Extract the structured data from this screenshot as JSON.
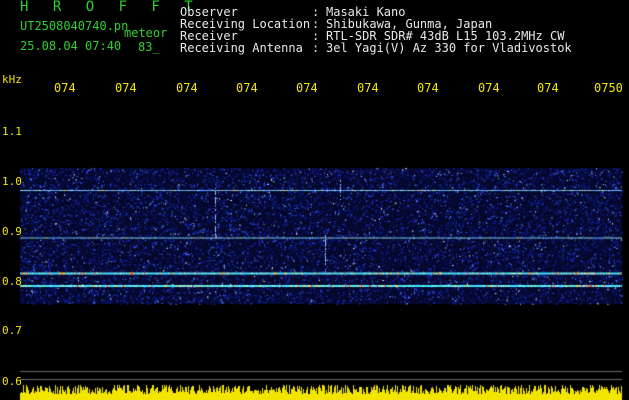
{
  "header": {
    "brand": "H R O F F T",
    "filename": "UT2508040740.pn",
    "datetime": "25.08.04 07:40",
    "mode": "meteor",
    "count": "83_"
  },
  "meta": [
    {
      "label": "Observer",
      "value": "Masaki Kano"
    },
    {
      "label": "Receiving Location",
      "value": "Shibukawa, Gunma, Japan"
    },
    {
      "label": "Receiver",
      "value": "RTL-SDR SDR# 43dB L15 103.2MHz CW"
    },
    {
      "label": "Receiving Antenna",
      "value": "3el Yagi(V) Az 330 for Vladivostok"
    }
  ],
  "axis": {
    "unit": "kHz",
    "time_ticks": [
      "074",
      "074",
      "074",
      "074",
      "074",
      "074",
      "074",
      "074",
      "074",
      "0750"
    ],
    "freq_ticks": [
      "1.1",
      "1.0",
      "0.9",
      "0.8",
      "0.7",
      "0.6"
    ],
    "freq_values": [
      1.1,
      1.0,
      0.9,
      0.8,
      0.7,
      0.6
    ]
  },
  "spectrum": {
    "band_lines_khz": [
      0.98,
      0.885,
      0.815,
      0.79
    ],
    "noise_band_khz": [
      0.78,
      1.0
    ]
  },
  "colors": {
    "brand": "#2fd02f",
    "text": "#e8e8e8",
    "axis": "#f2e600",
    "noise": "#1a2fd0"
  }
}
